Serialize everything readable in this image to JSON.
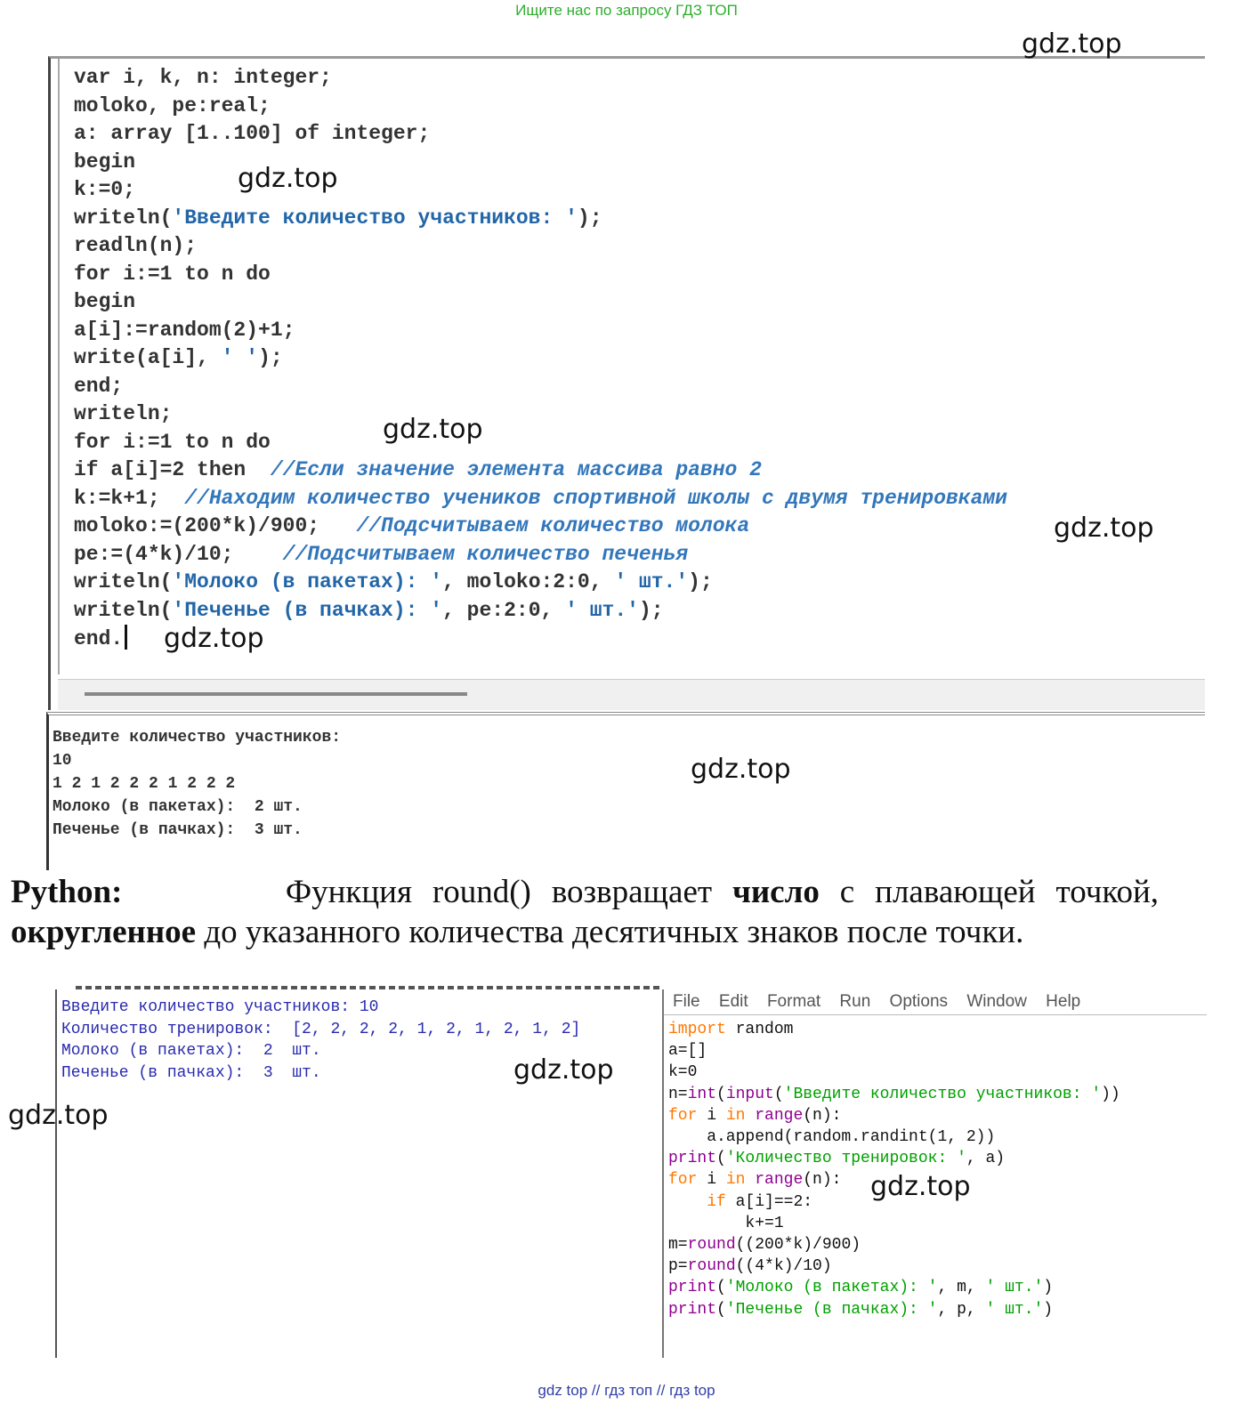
{
  "top_banner": "Ищите нас по запросу ГДЗ ТОП",
  "bottom_banner": "gdz top // гдз топ // гдз top",
  "watermark": "gdz.top",
  "pascal": {
    "l1": "var i, k, n: integer;",
    "l2": "moloko, pe:real;",
    "l3": "a: array [1..100] of integer;",
    "l4": "begin",
    "l5": "k:=0;",
    "l6a": "writeln(",
    "l6s": "'Введите количество участников: '",
    "l6b": ");",
    "l7": "readln(n);",
    "l8": "for i:=1 to n do",
    "l9": "begin",
    "l10": "a[i]:=random(2)+1;",
    "l11a": "write(a[i], ",
    "l11s": "' '",
    "l11b": ");",
    "l12": "end;",
    "l13": "writeln;",
    "l14": "for i:=1 to n do",
    "l15a": "if a[i]=2 then  ",
    "l15c": "//Если значение элемента массива равно 2",
    "l16a": "k:=k+1;  ",
    "l16c": "//Находим количество учеников спортивной школы с двумя тренировками",
    "l17a": "moloko:=(200*k)/900;   ",
    "l17c": "//Подсчитываем количество молока",
    "l18a": "pe:=(4*k)/10;    ",
    "l18c": "//Подсчитываем количество печенья",
    "l19a": "writeln(",
    "l19s": "'Молоко (в пакетах): '",
    "l19b": ", moloko:2:0, ",
    "l19s2": "' шт.'",
    "l19c": ");",
    "l20a": "writeln(",
    "l20s": "'Печенье (в пачках): '",
    "l20b": ", pe:2:0, ",
    "l20s2": "' шт.'",
    "l20c": ");",
    "l21": "end."
  },
  "pascal_output": {
    "o1": "Введите количество участников:",
    "o2": "10",
    "o3": "1 2 1 2 2 2 1 2 2 2",
    "o4": "Молоко (в пакетах):  2 шт.",
    "o5": "Печенье (в пачках):  3 шт."
  },
  "paragraph": {
    "p1": "Python:",
    "p2": "Функция round() возвращает ",
    "p3": "число",
    "p4": " с плавающей точкой, ",
    "p5": "округленное",
    "p6": " до указанного количества десятичных знаков после точки."
  },
  "python_shell": {
    "s1": "Введите количество участников: 10",
    "s2": "Количество тренировок:  [2, 2, 2, 2, 1, 2, 1, 2, 1, 2]",
    "s3": "Молоко (в пакетах):  2  шт.",
    "s4": "Печенье (в пачках):  3  шт."
  },
  "python_menu": [
    "File",
    "Edit",
    "Format",
    "Run",
    "Options",
    "Window",
    "Help"
  ],
  "python_code": {
    "c1k": "import",
    "c1b": " random",
    "c2": "a=[]",
    "c3": "k=0",
    "c4a": "n=",
    "c4b1": "int",
    "c4p": "(",
    "c4b2": "input",
    "c4q": "(",
    "c4s": "'Введите количество участников: '",
    "c4e": "))",
    "c5k": "for",
    "c5a": " i ",
    "c5k2": "in",
    "c5sp": " ",
    "c5b": "range",
    "c5e": "(n):",
    "c6": "    a.append(random.randint(1, 2))",
    "c7b": "print",
    "c7p": "(",
    "c7s": "'Количество тренировок: '",
    "c7e": ", a)",
    "c8k": "for",
    "c8a": " i ",
    "c8k2": "in",
    "c8sp": " ",
    "c8b": "range",
    "c8e": "(n):",
    "c9i": "    ",
    "c9k": "if",
    "c9e": " a[i]==2:",
    "c10": "        k+=1",
    "c11a": "m=",
    "c11b": "round",
    "c11e": "((200*k)/900)",
    "c12a": "p=",
    "c12b": "round",
    "c12e": "((4*k)/10)",
    "c13b": "print",
    "c13p": "(",
    "c13s": "'Молоко (в пакетах): '",
    "c13m": ", m, ",
    "c13s2": "' шт.'",
    "c13e": ")",
    "c14b": "print",
    "c14p": "(",
    "c14s": "'Печенье (в пачках): '",
    "c14m": ", p, ",
    "c14s2": "' шт.'",
    "c14e": ")"
  },
  "colors": {
    "banner_green": "#2fae2f",
    "banner_blue": "#2f3fa8",
    "pascal_string": "#2266a8",
    "py_keyword": "#ff7700",
    "py_builtin": "#900090",
    "py_string": "#00a000",
    "shell_text": "#2a2ab0"
  }
}
